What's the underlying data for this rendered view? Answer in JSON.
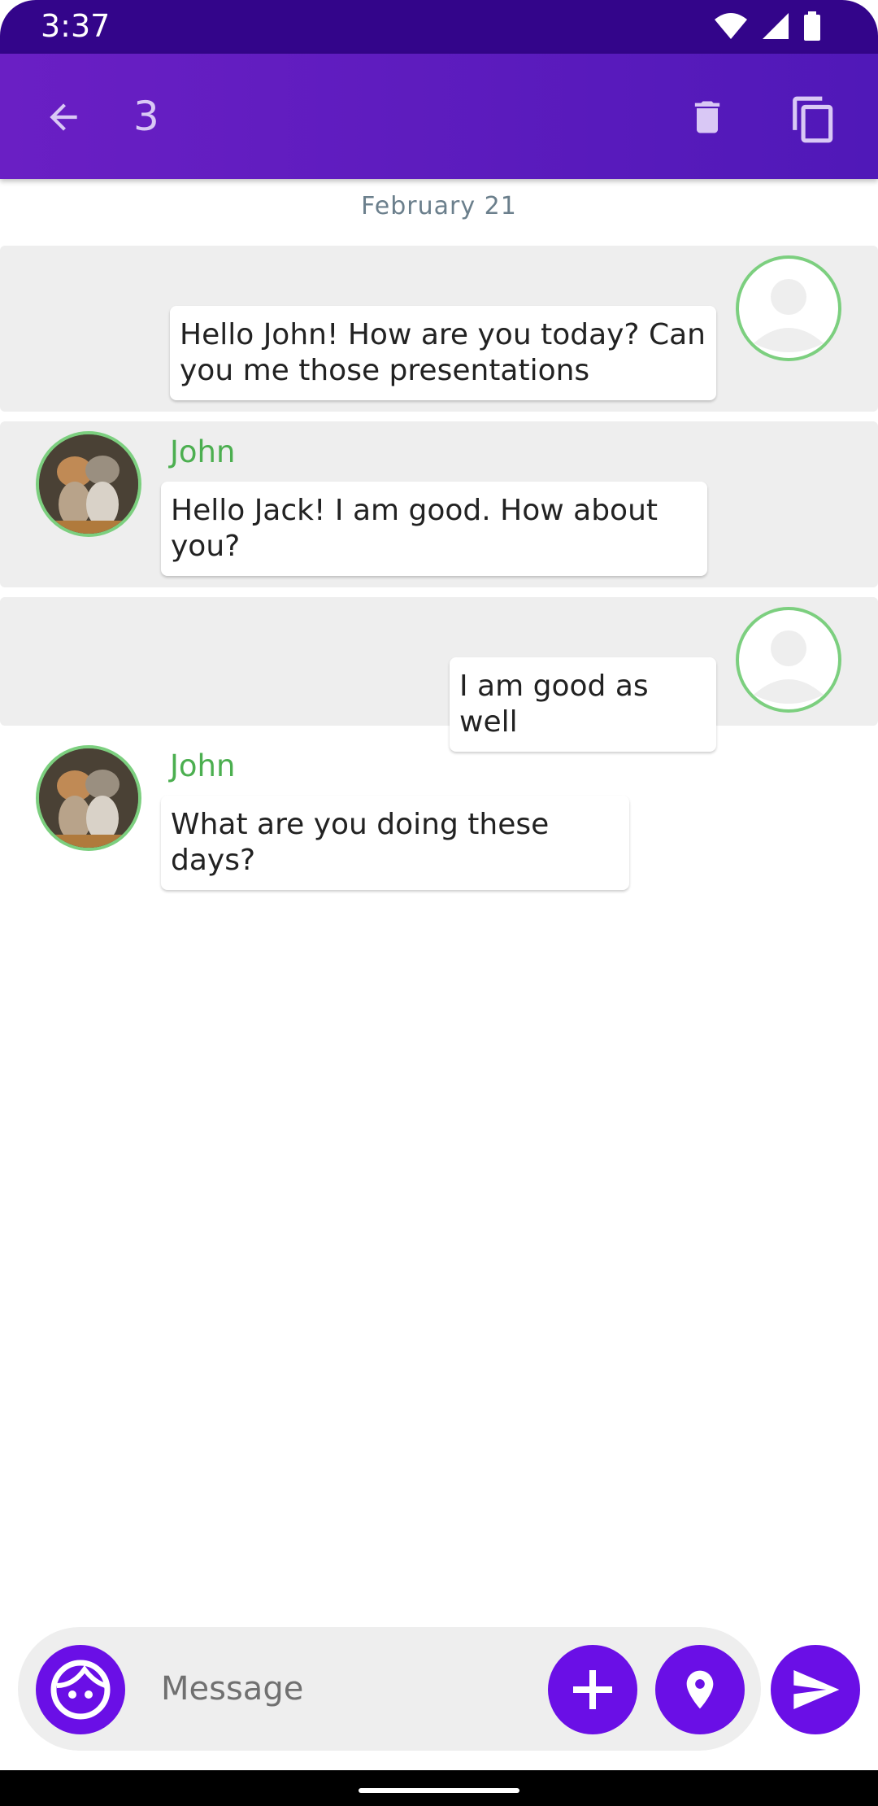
{
  "status_bar": {
    "time": "3:37"
  },
  "app_bar": {
    "selected_count": "3"
  },
  "chat": {
    "date": "February 21",
    "messages": [
      {
        "sender": "",
        "text": "Hello John! How are you today? Can you me those presentations",
        "outgoing": true,
        "selected": true
      },
      {
        "sender": "John",
        "text": "Hello Jack! I am good. How about you?",
        "outgoing": false,
        "selected": true
      },
      {
        "sender": "",
        "text": "I am good as well",
        "outgoing": true,
        "selected": true
      },
      {
        "sender": "John",
        "text": "What are you doing these days?",
        "outgoing": false,
        "selected": false
      }
    ]
  },
  "composer": {
    "placeholder": "Message"
  },
  "colors": {
    "primary": "#6a0fe6",
    "app_bar": "#5a1bc0",
    "sender": "#4caf50",
    "selected_row": "#eeeeee"
  }
}
